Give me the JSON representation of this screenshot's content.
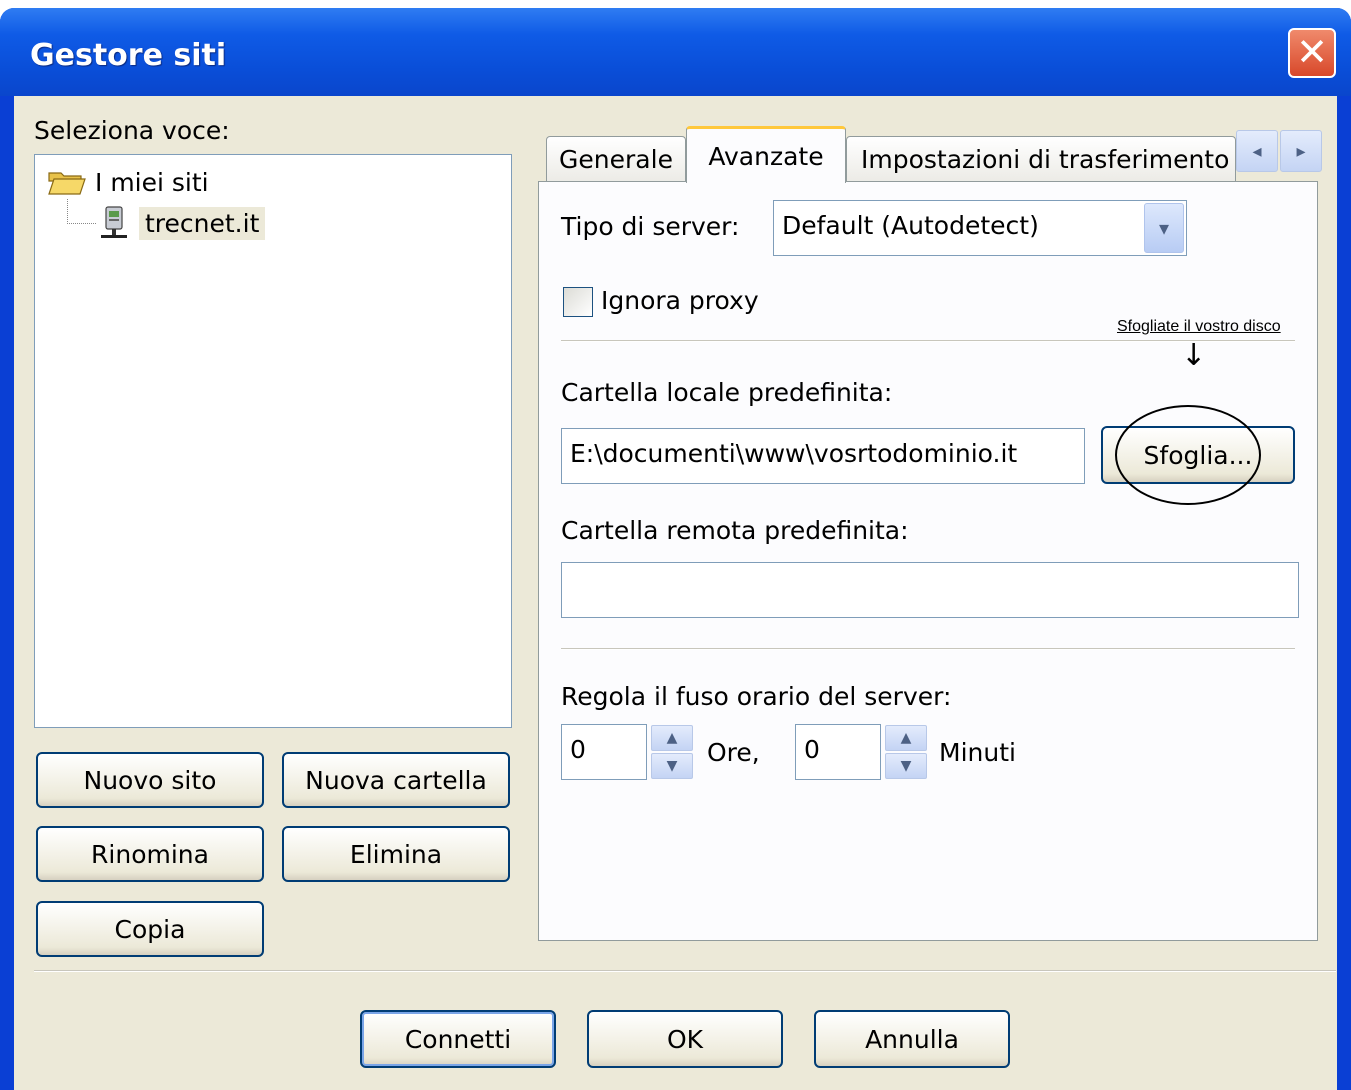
{
  "window": {
    "title": "Gestore siti",
    "close_glyph": "✕"
  },
  "left": {
    "select_label": "Seleziona voce:",
    "tree": {
      "root": "I miei siti",
      "child": "trecnet.it"
    },
    "buttons": {
      "new_site": "Nuovo sito",
      "new_folder": "Nuova cartella",
      "rename": "Rinomina",
      "delete": "Elimina",
      "copy": "Copia"
    }
  },
  "tabs": {
    "general": "Generale",
    "advanced": "Avanzate",
    "transfer": "Impostazioni di trasferimento",
    "prev_glyph": "◂",
    "next_glyph": "▸"
  },
  "advanced": {
    "server_type_label": "Tipo di server:",
    "server_type_value": "Default (Autodetect)",
    "bypass_proxy_label": "Ignora proxy",
    "bypass_proxy_checked": false,
    "local_dir_label": "Cartella locale predefinita:",
    "local_dir_value": "E:\\documenti\\www\\vosrtodominio.it",
    "browse_button": "Sfoglia...",
    "remote_dir_label": "Cartella remota predefinita:",
    "remote_dir_value": "",
    "timezone_label": "Regola il fuso orario del server:",
    "hours_value": "0",
    "hours_label": "Ore,",
    "minutes_value": "0",
    "minutes_label": "Minuti"
  },
  "annotation": {
    "text": "Sfogliate il vostro disco",
    "arrow_glyph": "↓"
  },
  "footer": {
    "connect": "Connetti",
    "ok": "OK",
    "cancel": "Annulla"
  },
  "colors": {
    "titlebar": "#0a4ed8",
    "client": "#ece9d8",
    "tab_highlight": "#ffc83c",
    "close": "#d8482a"
  }
}
